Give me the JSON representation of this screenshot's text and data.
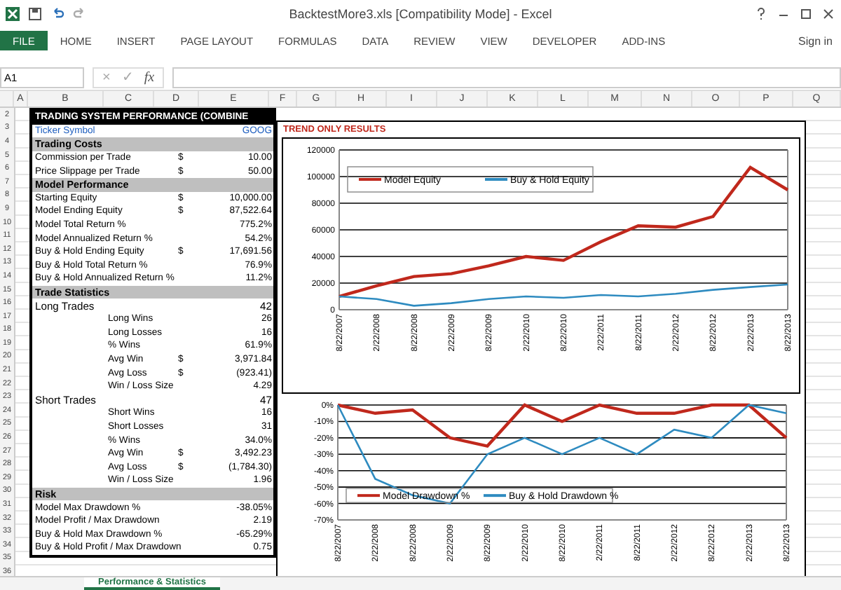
{
  "window": {
    "title": "BacktestMore3.xls [Compatibility Mode] - Excel",
    "sign_in": "Sign in"
  },
  "ribbon_tabs": [
    {
      "label": "FILE",
      "selected": true
    },
    {
      "label": "HOME",
      "selected": false
    },
    {
      "label": "INSERT",
      "selected": false
    },
    {
      "label": "PAGE LAYOUT",
      "selected": false
    },
    {
      "label": "FORMULAS",
      "selected": false
    },
    {
      "label": "DATA",
      "selected": false
    },
    {
      "label": "REVIEW",
      "selected": false
    },
    {
      "label": "VIEW",
      "selected": false
    },
    {
      "label": "DEVELOPER",
      "selected": false
    },
    {
      "label": "ADD-INS",
      "selected": false
    }
  ],
  "formula_bar": {
    "name_box": "A1",
    "cancel": "×",
    "enter": "✓",
    "function": "fx"
  },
  "columns": [
    "A",
    "B",
    "C",
    "D",
    "E",
    "F",
    "G",
    "H",
    "I",
    "J",
    "K",
    "L",
    "M",
    "N",
    "O",
    "P",
    "Q"
  ],
  "row_numbers": [
    "2",
    "3",
    "4",
    "5",
    "6",
    "7",
    "8",
    "9",
    "10",
    "11",
    "12",
    "13",
    "14",
    "15",
    "16",
    "17",
    "18",
    "19",
    "20",
    "21",
    "22",
    "23",
    "24",
    "25",
    "26",
    "27",
    "28",
    "29",
    "30",
    "31",
    "32",
    "33",
    "34",
    "35",
    "36"
  ],
  "table": [
    {
      "kind": "title",
      "label": "TRADING SYSTEM PERFORMANCE (COMBINE"
    },
    {
      "kind": "field",
      "label": "Ticker Symbol",
      "value": "GOOG"
    },
    {
      "kind": "section",
      "label": "Trading Costs"
    },
    {
      "kind": "item",
      "label": "Commission per Trade",
      "currency": "$",
      "value": "10.00"
    },
    {
      "kind": "item",
      "label": "Price Slippage per Trade",
      "currency": "$",
      "value": "50.00"
    },
    {
      "kind": "section",
      "label": "Model Performance"
    },
    {
      "kind": "item",
      "label": "Starting Equity",
      "currency": "$",
      "value": "10,000.00"
    },
    {
      "kind": "item",
      "label": "Model Ending Equity",
      "currency": "$",
      "value": "87,522.64"
    },
    {
      "kind": "item",
      "label": "Model Total Return %",
      "value": "775.2%"
    },
    {
      "kind": "item",
      "label": "Model Annualized Return %",
      "value": "54.2%"
    },
    {
      "kind": "item",
      "label": "Buy & Hold Ending Equity",
      "currency": "$",
      "value": "17,691.56"
    },
    {
      "kind": "item",
      "label": "Buy & Hold Total Return %",
      "value": "76.9%"
    },
    {
      "kind": "item",
      "label": "Buy & Hold Annualized Return %",
      "value": "11.2%"
    },
    {
      "kind": "section",
      "label": "Trade Statistics"
    },
    {
      "kind": "group",
      "label": "Long Trades",
      "value": "42"
    },
    {
      "kind": "sub",
      "label": "Long Wins",
      "value": "26"
    },
    {
      "kind": "sub",
      "label": "Long Losses",
      "value": "16"
    },
    {
      "kind": "sub",
      "label": "% Wins",
      "value": "61.9%"
    },
    {
      "kind": "sub",
      "label": "Avg Win",
      "currency": "$",
      "value": "3,971.84"
    },
    {
      "kind": "sub",
      "label": "Avg Loss",
      "currency": "$",
      "value": "(923.41)"
    },
    {
      "kind": "sub",
      "label": "Win / Loss Size",
      "value": "4.29"
    },
    {
      "kind": "group",
      "label": "Short Trades",
      "value": "47"
    },
    {
      "kind": "sub",
      "label": "Short Wins",
      "value": "16"
    },
    {
      "kind": "sub",
      "label": "Short Losses",
      "value": "31"
    },
    {
      "kind": "sub",
      "label": "% Wins",
      "value": "34.0%"
    },
    {
      "kind": "sub",
      "label": "Avg Win",
      "currency": "$",
      "value": "3,492.23"
    },
    {
      "kind": "sub",
      "label": "Avg Loss",
      "currency": "$",
      "value": "(1,784.30)"
    },
    {
      "kind": "sub",
      "label": "Win / Loss Size",
      "value": "1.96"
    },
    {
      "kind": "section",
      "label": "Risk"
    },
    {
      "kind": "item",
      "label": "Model Max Drawdown %",
      "value": "-38.05%"
    },
    {
      "kind": "item",
      "label": "Model Profit / Max Drawdown",
      "value": "2.19"
    },
    {
      "kind": "item",
      "label": "Buy & Hold Max Drawdown %",
      "value": "-65.29%"
    },
    {
      "kind": "item",
      "label": "Buy & Hold Profit / Max Drawdown",
      "value": "0.75"
    }
  ],
  "chart_panel": {
    "title": "TREND ONLY RESULTS",
    "equity_chart": {
      "chart_data": {
        "type": "line",
        "categories": [
          "8/22/2007",
          "2/22/2008",
          "8/22/2008",
          "2/22/2009",
          "8/22/2009",
          "2/22/2010",
          "8/22/2010",
          "2/22/2011",
          "8/22/2011",
          "2/22/2012",
          "8/22/2012",
          "2/22/2013",
          "8/22/2013"
        ],
        "series": [
          {
            "name": "Model Equity",
            "color": "#c0281c",
            "values": [
              10000,
              18000,
              25000,
              27000,
              33000,
              40000,
              37000,
              51000,
              63000,
              62000,
              70000,
              107000,
              90000
            ]
          },
          {
            "name": "Buy & Hold Equity",
            "color": "#2e8bc0",
            "values": [
              10000,
              8000,
              3000,
              5000,
              8000,
              10000,
              9000,
              11000,
              10000,
              12000,
              15000,
              17000,
              19000
            ]
          }
        ],
        "grid": true,
        "legend": true,
        "ylim": [
          0,
          120000
        ],
        "yticks": [
          0,
          20000,
          40000,
          60000,
          80000,
          100000,
          120000
        ]
      }
    },
    "drawdown_chart": {
      "chart_data": {
        "type": "line",
        "categories": [
          "8/22/2007",
          "2/22/2008",
          "8/22/2008",
          "2/22/2009",
          "8/22/2009",
          "2/22/2010",
          "8/22/2010",
          "2/22/2011",
          "8/22/2011",
          "2/22/2012",
          "8/22/2012",
          "2/22/2013",
          "8/22/2013"
        ],
        "series": [
          {
            "name": "Model Drawdown %",
            "color": "#c0281c",
            "values": [
              0,
              -5,
              -3,
              -20,
              -25,
              0,
              -10,
              0,
              -5,
              -5,
              0,
              0,
              -20
            ]
          },
          {
            "name": "Buy & Hold Drawdown %",
            "color": "#2e8bc0",
            "values": [
              0,
              -45,
              -55,
              -60,
              -30,
              -20,
              -30,
              -20,
              -30,
              -15,
              -20,
              0,
              -5
            ]
          }
        ],
        "grid": true,
        "legend": true,
        "ylim": [
          -70,
          0
        ],
        "yticks": [
          {
            "value": 0,
            "label": "0%"
          },
          {
            "value": -10,
            "label": "-10%"
          },
          {
            "value": -20,
            "label": "-20%"
          },
          {
            "value": -30,
            "label": "-30%"
          },
          {
            "value": -40,
            "label": "-40%"
          },
          {
            "value": -50,
            "label": "-50%"
          },
          {
            "value": -60,
            "label": "-60%"
          },
          {
            "value": -70,
            "label": "-70%"
          }
        ]
      }
    }
  },
  "sheet_tabs": [
    {
      "label": "Performance & Statistics",
      "selected": true
    }
  ]
}
